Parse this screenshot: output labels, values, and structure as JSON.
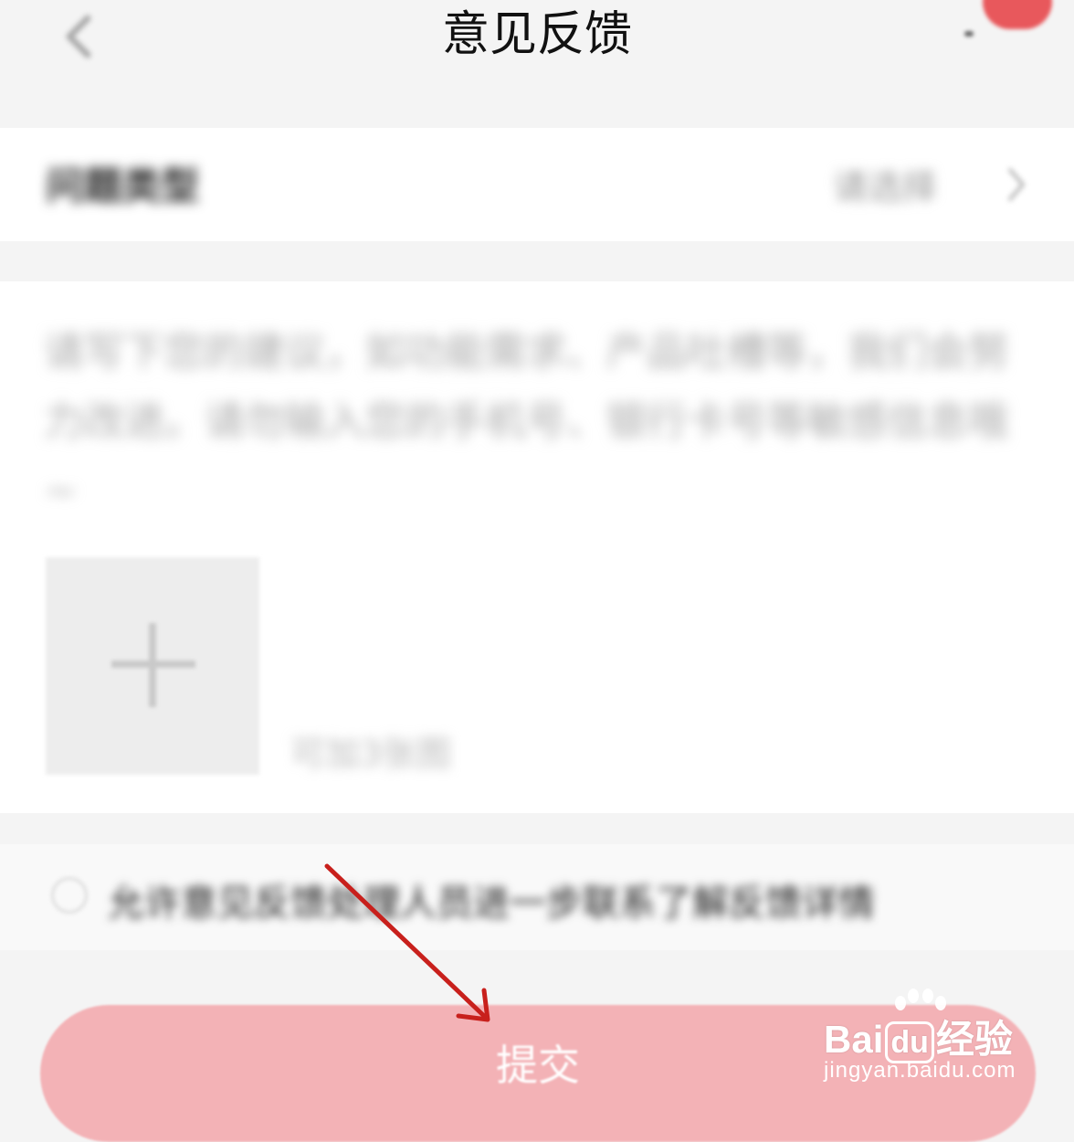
{
  "header": {
    "title": "意见反馈",
    "back_icon": "chevron-left-icon"
  },
  "problem_type": {
    "label": "问题类型",
    "value": "请选择",
    "chevron_icon": "chevron-right-icon"
  },
  "feedback": {
    "placeholder": "请写下您的建议，如功能需求、产品吐槽等，我们会努力改进。请勿输入您的手机号、银行卡号等敏感信息哦~",
    "upload_icon": "plus-icon",
    "upload_hint": "可加3张图"
  },
  "consent": {
    "text": "允许意见反馈处理人员进一步联系了解反馈详情",
    "checked": false
  },
  "submit": {
    "label": "提交",
    "color": "#f3b2b6"
  },
  "annotation": {
    "arrow_color": "#c8201c"
  },
  "watermark": {
    "brand_prefix": "Bai",
    "brand_du": "du",
    "brand_suffix": "经验",
    "url": "jingyan.baidu.com"
  }
}
